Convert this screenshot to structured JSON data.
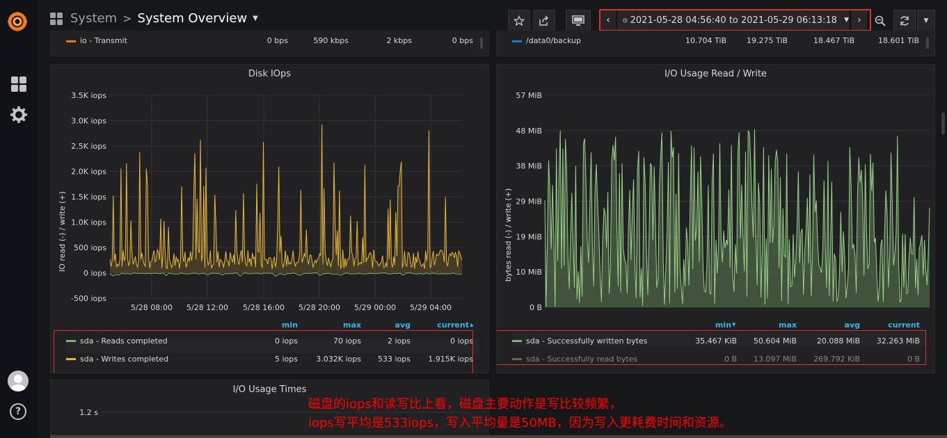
{
  "nav": {
    "folder": "System",
    "separator": ">",
    "dashboard": "System Overview",
    "time_range": "2021-05-28 04:56:40 to 2021-05-29 06:13:18"
  },
  "top_rows": {
    "left": {
      "label": "io - Transmit",
      "values": [
        "0 bps",
        "590 kbps",
        "2 kbps",
        "0 bps"
      ],
      "color": "#e0752d"
    },
    "right": {
      "label": "/data0/backup",
      "values": [
        "10.704 TiB",
        "19.275 TiB",
        "18.467 TiB",
        "18.601 TiB"
      ],
      "color": "#1f78c1"
    }
  },
  "panels": {
    "disk_iops": {
      "title": "Disk IOps",
      "ylabel": "IO read (-) / write (+)",
      "legend_headers": [
        "min",
        "max",
        "avg",
        "current"
      ],
      "series": [
        {
          "name": "sda - Reads completed",
          "color": "#7eb26d",
          "min": "0 iops",
          "max": "70 iops",
          "avg": "2 iops",
          "current": "0 iops"
        },
        {
          "name": "sda - Writes completed",
          "color": "#eab839",
          "min": "5 iops",
          "max": "3.032K iops",
          "avg": "533 iops",
          "current": "1.915K iops"
        }
      ]
    },
    "io_usage": {
      "title": "I/O Usage Read / Write",
      "ylabel": "bytes read (-) / write (+)",
      "legend_headers": [
        "min",
        "max",
        "avg",
        "current"
      ],
      "series": [
        {
          "name": "sda - Successfully written bytes",
          "color": "#7eb26d",
          "min": "35.467 KiB",
          "max": "50.604 MiB",
          "avg": "20.088 MiB",
          "current": "32.263 MiB"
        },
        {
          "name": "sda - Successfully read bytes",
          "color": "#7eb26d",
          "min": "0 B",
          "max": "13.097 MiB",
          "avg": "269.792 KiB",
          "current": "0 B"
        }
      ]
    },
    "io_times": {
      "title": "I/O Usage Times",
      "ytick": "1.2 s"
    }
  },
  "chart_data": [
    {
      "type": "line",
      "title": "Disk IOps",
      "ylabel": "IO read (-) / write (+)",
      "yticks": [
        "3.5K iops",
        "3.0K iops",
        "2.5K iops",
        "2.0K iops",
        "1.5K iops",
        "1.0K iops",
        "500 iops",
        "0 iops",
        "-500 iops"
      ],
      "ylim": [
        -500,
        3500
      ],
      "xticks": [
        "5/28 08:00",
        "5/28 12:00",
        "5/28 16:00",
        "5/28 20:00",
        "5/29 00:00",
        "5/29 04:00"
      ],
      "series": [
        {
          "name": "sda - Writes completed",
          "color": "#eab839",
          "avg": 533,
          "max": 3032
        },
        {
          "name": "sda - Reads completed",
          "color": "#7eb26d",
          "avg": 2,
          "max": 70
        }
      ]
    },
    {
      "type": "line",
      "title": "I/O Usage Read / Write",
      "ylabel": "bytes read (-) / write (+)",
      "yticks": [
        "57 MiB",
        "48 MiB",
        "38 MiB",
        "29 MiB",
        "19 MiB",
        "10 MiB",
        "0 B"
      ],
      "ylim": [
        0,
        57
      ],
      "series": [
        {
          "name": "sda - Successfully written bytes",
          "color": "#7eb26d",
          "avg": 20.088,
          "max": 50.604
        }
      ]
    }
  ],
  "annotation": {
    "line1": "磁盘的iops和读写比上看，磁盘主要动作是写比较频繁，",
    "line2": "iops写平均是533iops，写入平均量是50MB，因为写入更耗费时间和资源。"
  }
}
